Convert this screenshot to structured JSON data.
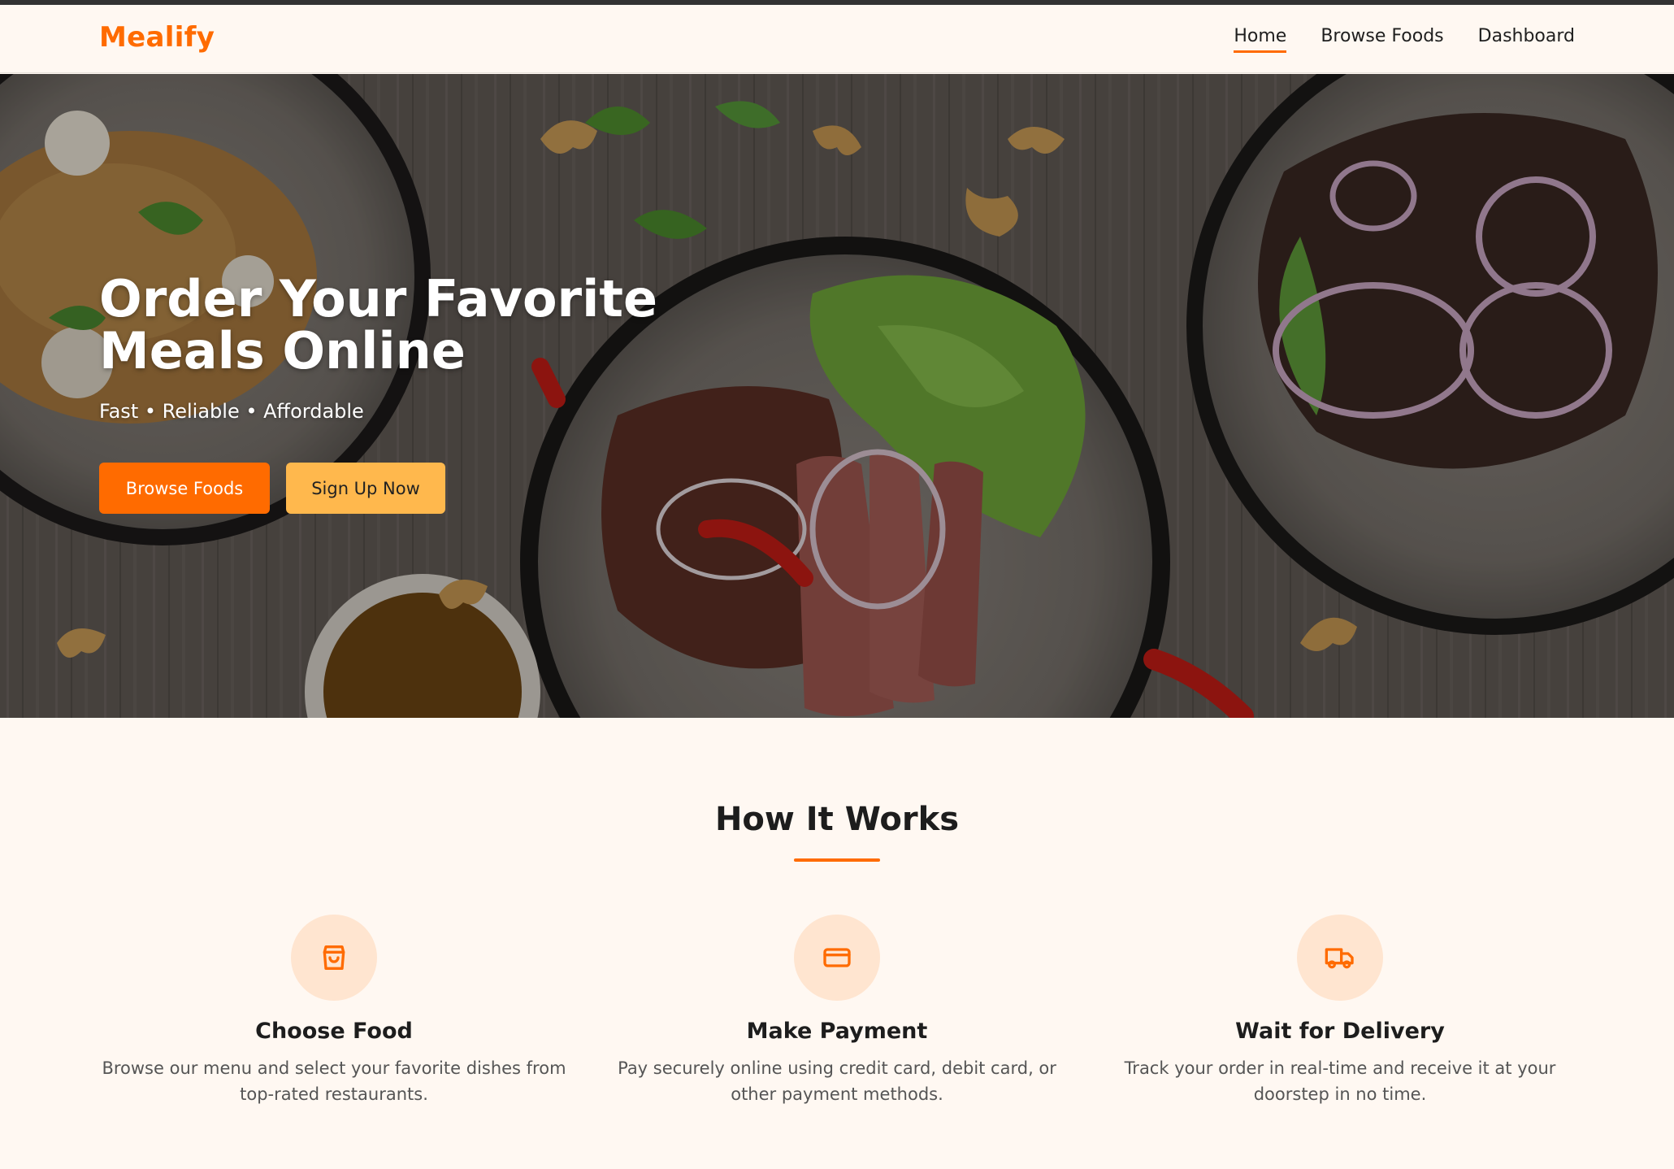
{
  "header": {
    "brand": "Mealify",
    "nav": [
      {
        "label": "Home",
        "active": true
      },
      {
        "label": "Browse Foods",
        "active": false
      },
      {
        "label": "Dashboard",
        "active": false
      }
    ]
  },
  "hero": {
    "title": "Order Your Favorite Meals Online",
    "subtitle": "Fast • Reliable • Affordable",
    "primary_button": "Browse Foods",
    "secondary_button": "Sign Up Now"
  },
  "how_it_works": {
    "title": "How It Works",
    "steps": [
      {
        "icon": "shopping-bag-icon",
        "title": "Choose Food",
        "description": "Browse our menu and select your favorite dishes from top-rated restaurants."
      },
      {
        "icon": "credit-card-icon",
        "title": "Make Payment",
        "description": "Pay securely online using credit card, debit card, or other payment methods."
      },
      {
        "icon": "truck-icon",
        "title": "Wait for Delivery",
        "description": "Track your order in real-time and receive it at your doorstep in no time."
      }
    ]
  },
  "colors": {
    "accent": "#ff6b00",
    "secondary": "#ffb84d",
    "background": "#fff8f2",
    "icon_bg": "#ffe5d0"
  }
}
